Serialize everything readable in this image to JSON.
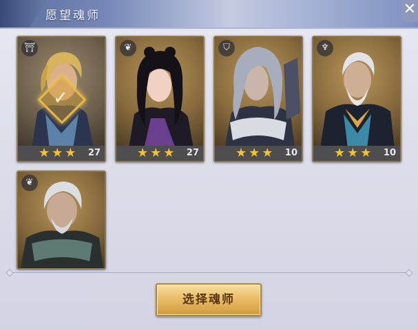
{
  "header": {
    "title": "愿望魂师",
    "close_label": "✕"
  },
  "heroes": [
    {
      "stars": "★★★",
      "level": "27",
      "role_icon": "gate-icon",
      "selected": true
    },
    {
      "stars": "★★★",
      "level": "27",
      "role_icon": "feather-icon",
      "selected": false
    },
    {
      "stars": "★★★",
      "level": "10",
      "role_icon": "shield-icon",
      "selected": false
    },
    {
      "stars": "★★★",
      "level": "10",
      "role_icon": "wing-icon",
      "selected": false
    },
    {
      "stars": "",
      "level": "",
      "role_icon": "feather-icon",
      "selected": false
    }
  ],
  "select_button": {
    "label": "选择魂师"
  },
  "colors": {
    "accent_gold": "#e9bb63",
    "star": "#f0c23a",
    "header_blue": "#5b6f9e"
  }
}
